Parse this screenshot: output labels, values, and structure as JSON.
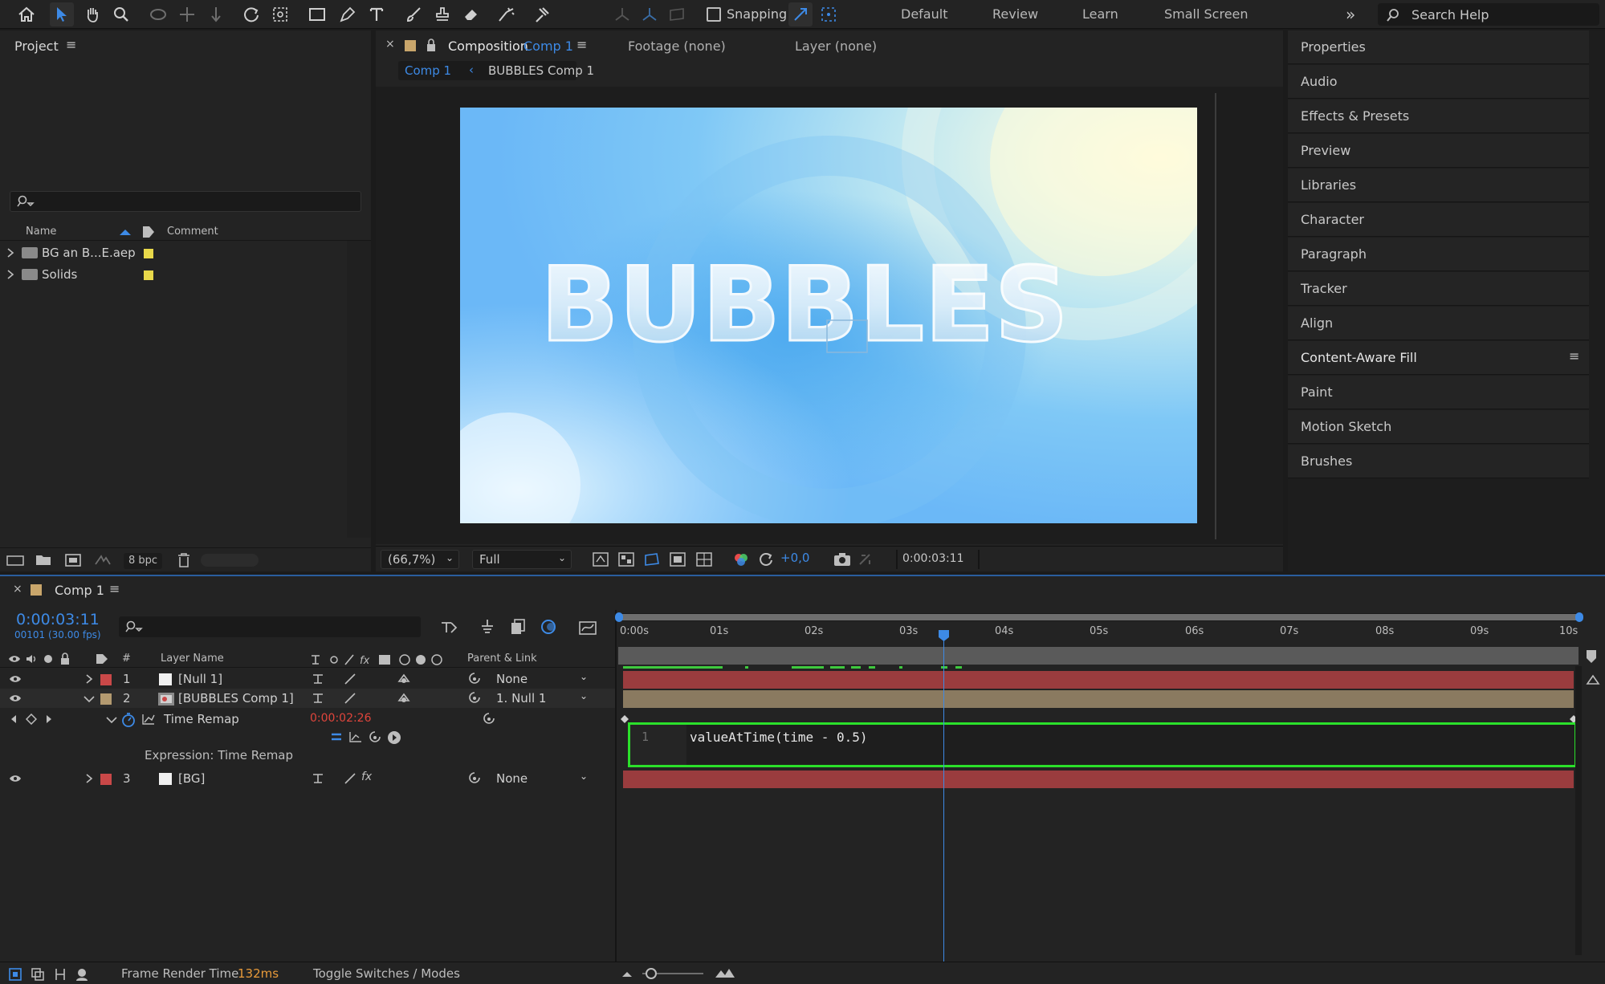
{
  "workspaces": [
    "Default",
    "Review",
    "Learn",
    "Small Screen"
  ],
  "toolbar": {
    "snapping_label": "Snapping",
    "search_placeholder": "Search Help"
  },
  "project": {
    "title": "Project",
    "columns": {
      "name": "Name",
      "comment": "Comment"
    },
    "items": [
      {
        "label": "BG an B...E.aep",
        "color": "#e8d84a"
      },
      {
        "label": "Solids",
        "color": "#e8d84a"
      }
    ],
    "bpc": "8 bpc"
  },
  "composition": {
    "tab_prefix": "Composition",
    "tab_name": "Comp 1",
    "footage_tab": "Footage (none)",
    "layer_tab": "Layer (none)",
    "breadcrumb_current": "Comp 1",
    "breadcrumb_child": "BUBBLES Comp 1",
    "viewer_text": "BUBBLES",
    "zoom": "(66,7%)",
    "resolution": "Full",
    "exposure": "+0,0",
    "timecode": "0:00:03:11"
  },
  "right_panels": [
    "Properties",
    "Audio",
    "Effects & Presets",
    "Preview",
    "Libraries",
    "Character",
    "Paragraph",
    "Tracker",
    "Align",
    "Content-Aware Fill",
    "Paint",
    "Motion Sketch",
    "Brushes"
  ],
  "timeline": {
    "tab_name": "Comp 1",
    "current_time": "0:00:03:11",
    "frame_info": "00101 (30.00 fps)",
    "columns": {
      "num": "#",
      "layer_name": "Layer Name",
      "parent": "Parent & Link"
    },
    "ruler": [
      "0:00s",
      "01s",
      "02s",
      "03s",
      "04s",
      "05s",
      "06s",
      "07s",
      "08s",
      "09s",
      "10s"
    ],
    "layers": [
      {
        "num": "1",
        "name": "[Null 1]",
        "color": "#c94848",
        "parent": "None"
      },
      {
        "num": "2",
        "name": "[BUBBLES Comp 1]",
        "color": "#b39a70",
        "parent": "1. Null 1"
      },
      {
        "num": "3",
        "name": "[BG]",
        "color": "#c94848",
        "parent": "None"
      }
    ],
    "property": {
      "name": "Time Remap",
      "value": "0:00:02:26"
    },
    "expression_label": "Expression: Time Remap",
    "expression": {
      "line_number": "1",
      "code": "valueAtTime(time - 0.5)"
    }
  },
  "footer": {
    "render_label": "Frame Render Time",
    "render_value": "132ms",
    "toggle_label": "Toggle Switches / Modes"
  }
}
